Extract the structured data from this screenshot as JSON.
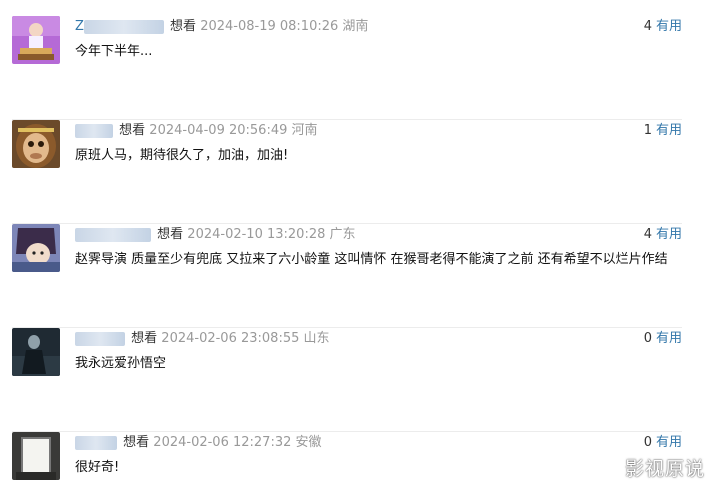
{
  "comments": [
    {
      "name_initial": "Z",
      "status": "想看",
      "timestamp": "2024-08-19 08:10:26",
      "location": "湖南",
      "votes": "4",
      "useful_label": "有用",
      "text": "今年下半年..."
    },
    {
      "name_initial": "",
      "status": "想看",
      "timestamp": "2024-04-09 20:56:49",
      "location": "河南",
      "votes": "1",
      "useful_label": "有用",
      "text": "原班人马，期待很久了，加油，加油!"
    },
    {
      "name_initial": "",
      "status": "想看",
      "timestamp": "2024-02-10 13:20:28",
      "location": "广东",
      "votes": "4",
      "useful_label": "有用",
      "text": "赵霁导演 质量至少有兜底 又拉来了六小龄童 这叫情怀 在猴哥老得不能演了之前 还有希望不以烂片作结"
    },
    {
      "name_initial": "",
      "status": "想看",
      "timestamp": "2024-02-06 23:08:55",
      "location": "山东",
      "votes": "0",
      "useful_label": "有用",
      "text": "我永远爱孙悟空"
    },
    {
      "name_initial": "",
      "status": "想看",
      "timestamp": "2024-02-06 12:27:32",
      "location": "安徽",
      "votes": "0",
      "useful_label": "有用",
      "text": "很好奇!"
    }
  ],
  "watermark": "影视原说"
}
